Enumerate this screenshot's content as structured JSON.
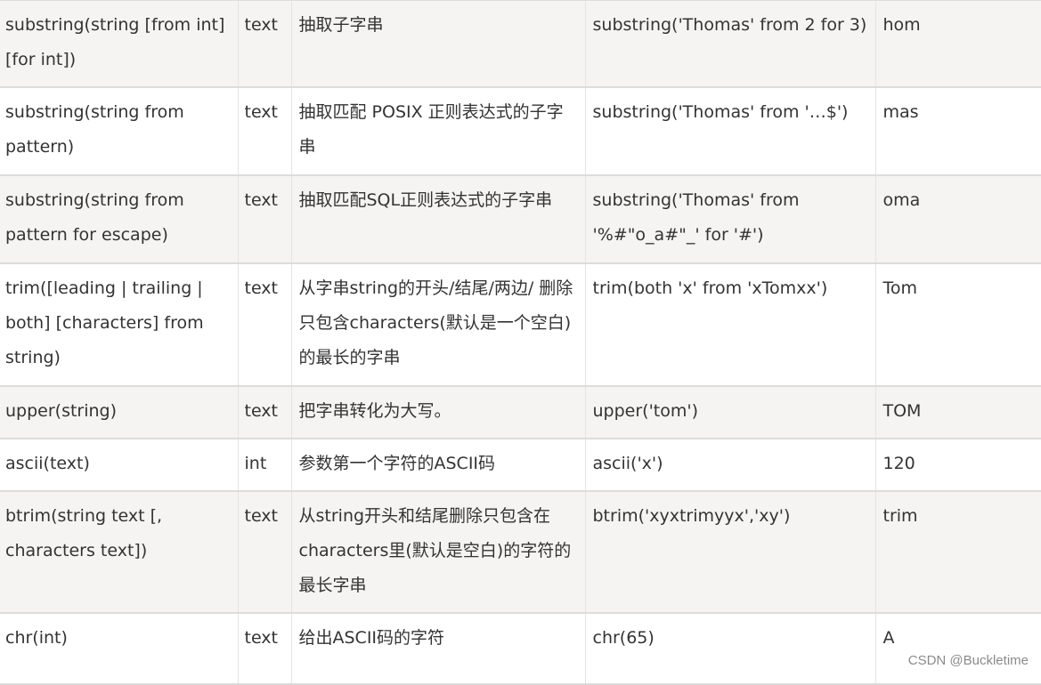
{
  "rows": [
    {
      "func": "substring(string [from int] [for int])",
      "type": "text",
      "desc": "抽取子字串",
      "example": "substring('Thomas' from 2 for 3)",
      "result": "hom"
    },
    {
      "func": "substring(string from pattern)",
      "type": "text",
      "desc": "抽取匹配 POSIX 正则表达式的子字串",
      "example": "substring('Thomas' from '…$')",
      "result": "mas"
    },
    {
      "func": "substring(string from pattern for escape)",
      "type": "text",
      "desc": "抽取匹配SQL正则表达式的子字串",
      "example": "substring('Thomas' from '%#\"o_a#\"_' for '#')",
      "result": "oma"
    },
    {
      "func": "trim([leading | trailing | both] [characters] from string)",
      "type": "text",
      "desc": "从字串string的开头/结尾/两边/ 删除只包含characters(默认是一个空白)的最长的字串",
      "example": "trim(both 'x' from 'xTomxx')",
      "result": "Tom"
    },
    {
      "func": "upper(string)",
      "type": "text",
      "desc": "把字串转化为大写。",
      "example": "upper('tom')",
      "result": "TOM"
    },
    {
      "func": "ascii(text)",
      "type": "int",
      "desc": "参数第一个字符的ASCII码",
      "example": "ascii('x')",
      "result": "120"
    },
    {
      "func": "btrim(string text [, characters text])",
      "type": "text",
      "desc": "从string开头和结尾删除只包含在characters里(默认是空白)的字符的最长字串",
      "example": "btrim('xyxtrimyyx','xy')",
      "result": "trim"
    },
    {
      "func": "chr(int)",
      "type": "text",
      "desc": "给出ASCII码的字符",
      "example": "chr(65)",
      "result": "A"
    }
  ],
  "watermark": "CSDN @Buckletime"
}
